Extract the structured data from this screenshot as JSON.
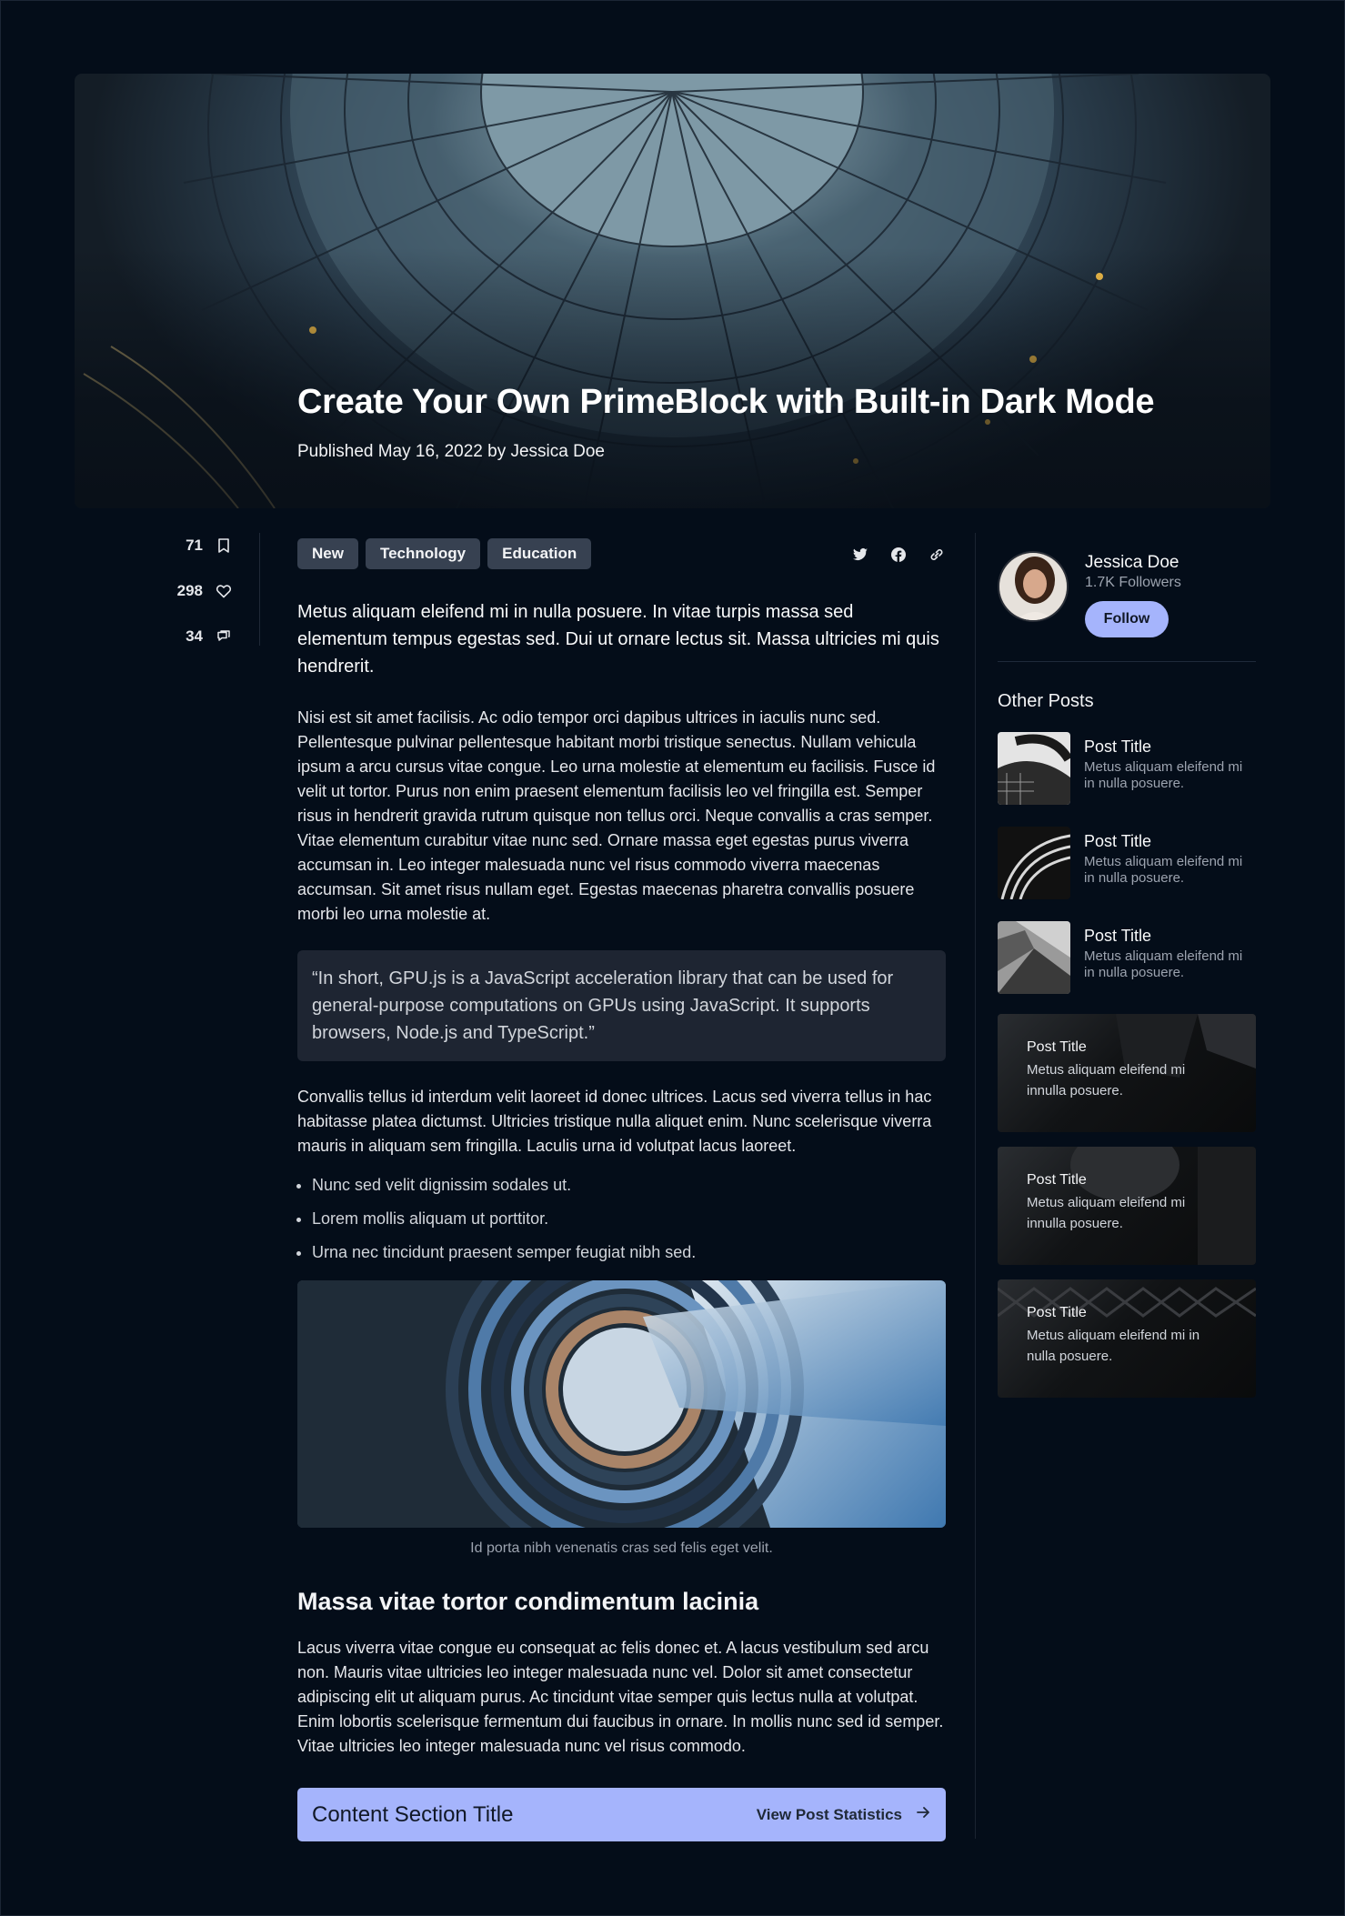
{
  "hero": {
    "title": "Create Your Own PrimeBlock with Built-in Dark Mode",
    "meta": "Published May 16, 2022 by Jessica Doe"
  },
  "stats": [
    {
      "value": "71",
      "icon": "bookmark-icon"
    },
    {
      "value": "298",
      "icon": "heart-icon"
    },
    {
      "value": "34",
      "icon": "comment-icon"
    }
  ],
  "tags": [
    "New",
    "Technology",
    "Education"
  ],
  "share_icons": [
    "twitter-icon",
    "facebook-icon",
    "link-icon"
  ],
  "article": {
    "lead": "Metus aliquam eleifend mi in nulla posuere. In vitae turpis massa sed elementum tempus egestas sed. Dui ut ornare lectus sit. Massa ultricies mi quis hendrerit.",
    "para1": "Nisi est sit amet facilisis. Ac odio tempor orci dapibus ultrices in iaculis nunc sed. Pellentesque pulvinar pellentesque habitant morbi tristique senectus. Nullam vehicula ipsum a arcu cursus vitae congue. Leo urna molestie at elementum eu facilisis. Fusce id velit ut tortor. Purus non enim praesent elementum facilisis leo vel fringilla est. Semper risus in hendrerit gravida rutrum quisque non tellus orci. Neque convallis a cras semper. Vitae elementum curabitur vitae nunc sed. Ornare massa eget egestas purus viverra accumsan in. Leo integer malesuada nunc vel risus commodo viverra maecenas accumsan. Sit amet risus nullam eget. Egestas maecenas pharetra convallis posuere morbi leo urna molestie at.",
    "quote": "“In short, GPU.js is a JavaScript acceleration library that can be used for general-purpose computations on GPUs using JavaScript. It supports browsers, Node.js and TypeScript.”",
    "para2": "Convallis tellus id interdum velit laoreet id donec ultrices. Lacus sed viverra tellus in hac habitasse platea dictumst. Ultricies tristique nulla aliquet enim. Nunc scelerisque viverra mauris in aliquam sem fringilla. Laculis urna id volutpat lacus laoreet.",
    "bullets": [
      "Nunc sed velit dignissim sodales ut.",
      "Lorem mollis aliquam ut porttitor.",
      "Urna nec tincidunt praesent semper feugiat nibh sed."
    ],
    "caption": "Id porta nibh venenatis cras sed felis eget velit.",
    "subheading": "Massa vitae tortor condimentum lacinia",
    "para3": "Lacus viverra vitae congue eu consequat ac felis donec et. A lacus vestibulum sed arcu non. Mauris vitae ultricies leo integer malesuada nunc vel. Dolor sit amet consectetur adipiscing elit ut aliquam purus. Ac tincidunt vitae semper quis lectus nulla at volutpat. Enim lobortis scelerisque fermentum dui faucibus in ornare. In mollis nunc sed id semper. Vitae ultricies leo integer malesuada nunc vel risus commodo.",
    "cta_title": "Content Section Title",
    "cta_link": "View Post Statistics"
  },
  "author": {
    "name": "Jessica Doe",
    "followers": "1.7K Followers",
    "follow_label": "Follow"
  },
  "other_posts": {
    "heading": "Other Posts",
    "list": [
      {
        "title": "Post Title",
        "desc": "Metus aliquam eleifend mi in nulla posuere."
      },
      {
        "title": "Post Title",
        "desc": "Metus aliquam eleifend mi in nulla posuere."
      },
      {
        "title": "Post Title",
        "desc": "Metus aliquam eleifend mi in nulla posuere."
      }
    ],
    "cards": [
      {
        "title": "Post Title",
        "desc": "Metus aliquam eleifend mi innulla posuere."
      },
      {
        "title": "Post Title",
        "desc": "Metus aliquam eleifend mi innulla posuere."
      },
      {
        "title": "Post Title",
        "desc": "Metus aliquam eleifend mi in nulla posuere."
      }
    ]
  },
  "colors": {
    "background": "#040d19",
    "accent": "#a5b4fc",
    "tag_bg": "#374151",
    "quote_bg": "#1e2532"
  }
}
